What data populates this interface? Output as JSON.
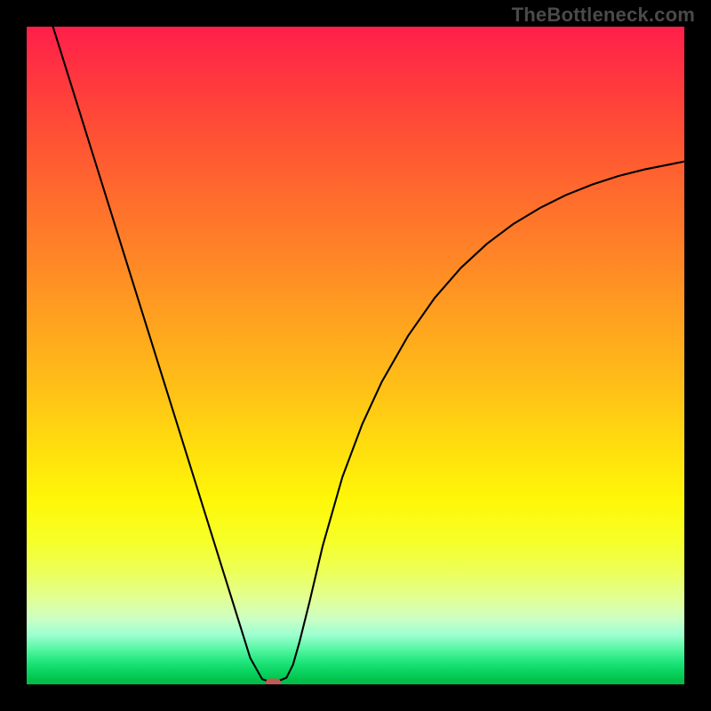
{
  "watermark": "TheBottleneck.com",
  "chart_data": {
    "type": "line",
    "title": "",
    "xlabel": "",
    "ylabel": "",
    "xlim": [
      0,
      100
    ],
    "ylim": [
      0,
      100
    ],
    "grid": false,
    "legend": false,
    "series": [
      {
        "name": "bottleneck-curve",
        "x": [
          4,
          6,
          8,
          10,
          12,
          14,
          16,
          18,
          20,
          22,
          24,
          26,
          28,
          30,
          32,
          34,
          35.8,
          37.5,
          39.5,
          40.5,
          41.5,
          43,
          45,
          48,
          51,
          54,
          58,
          62,
          66,
          70,
          74,
          78,
          82,
          86,
          90,
          94,
          98,
          100
        ],
        "y": [
          100,
          93.6,
          87.2,
          80.8,
          74.4,
          68.0,
          61.6,
          55.2,
          48.8,
          42.4,
          36.0,
          29.6,
          23.2,
          16.8,
          10.4,
          4.0,
          0.8,
          0.2,
          1.0,
          3.0,
          6.5,
          12.5,
          21.0,
          31.5,
          39.5,
          46.0,
          53.0,
          58.7,
          63.3,
          67.0,
          70.0,
          72.4,
          74.4,
          76.0,
          77.3,
          78.3,
          79.1,
          79.5
        ]
      }
    ],
    "marker": {
      "name": "minimum-point",
      "x": 37.5,
      "y": 0.2
    },
    "gradient_colors": {
      "top": "#ff1f4b",
      "mid": "#ffde0e",
      "bottom": "#00bb45"
    }
  }
}
